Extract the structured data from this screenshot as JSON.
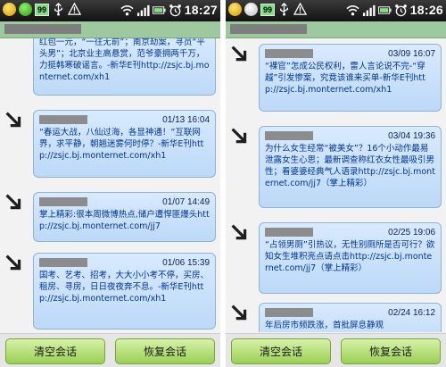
{
  "screens": [
    {
      "status": {
        "battery": "99",
        "time": "18:27"
      },
      "messages": [
        {
          "time": "",
          "text": "红包一元，“一往无前”；南京劫案，寻员“平头男”；北京业主高悬赏，范爷豪拥两千万，力挺韩寒破谣言。-新华E刊http://zsjc.bj.monternet.com/xh1"
        },
        {
          "time": "01/13 16:04",
          "text": "“春运大战，八仙过海，各显神通！”互联网界，求平静，朝翘迷雾何时停？-新华E刊http://zsjc.bj.monternet.com/xh1"
        },
        {
          "time": "01/07 14:49",
          "text": "掌上精彩:很本周微博热点,储户遭悍匪爆头http://zsjc.bj.monternet.com/jj7"
        },
        {
          "time": "01/06 15:39",
          "text": "国考、艺考、招考，大大小小考不停，买房、租房、寻房，日日夜夜奔不息。-新华E刊http://zsjc.bj.monternet.com/xh1"
        }
      ],
      "buttons": {
        "clear": "清空会话",
        "restore": "恢复会话"
      }
    },
    {
      "status": {
        "battery": "99",
        "time": "18:26"
      },
      "messages": [
        {
          "time": "03/09 16:07",
          "text": "“裸官”怎成公民权利，雷人言论说不完-“穿越”引发惨案，究竟该谁来买单-新华E刊http://zsjc.bj.monternet.com/xh1"
        },
        {
          "time": "03/04 19:36",
          "text": "为什么女生经常“被美女”？16个小动作最易泄露女生心思；最新调查称红衣女性最吸引男性；看婆婆经典气人语录http://zsjc.bj.monternet.com/jj7（掌上精彩）"
        },
        {
          "time": "02/25 19:06",
          "text": "“占领男厕”引热议，无性别厕所是否可行？欲知女生堆积亮点请点击http://zsjc.bj.monternet.com/jj7（掌上精彩）"
        },
        {
          "time": "02/24 16:12",
          "text": "年后房市频跌涨，首批屏息静观"
        }
      ],
      "buttons": {
        "clear": "清空会话",
        "restore": "恢复会话"
      }
    }
  ]
}
